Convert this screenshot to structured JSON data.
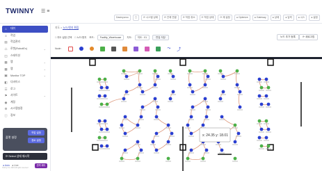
{
  "app": {
    "logo": "TWINNY",
    "menu_toggle": "☰ ≡"
  },
  "status": [
    {
      "caption": "",
      "value": "Dasinyuroo"
    },
    {
      "caption": "",
      "value": "▢"
    },
    {
      "caption": "",
      "value": "⟳ 시스템 상태"
    },
    {
      "caption": "",
      "value": "⟳ 관제 연결"
    },
    {
      "caption": "",
      "value": "⟳ 작업 취소"
    },
    {
      "caption": "",
      "value": "⟳ 작업 상태"
    },
    {
      "caption": "",
      "value": "⟳ 재 설정"
    },
    {
      "caption": "",
      "value": "● Optimize"
    },
    {
      "caption": "",
      "value": "● Gateway"
    },
    {
      "caption": "",
      "value": "● 상태"
    },
    {
      "caption": "",
      "value": "● 입력"
    },
    {
      "caption": "",
      "value": "● 시스"
    },
    {
      "caption": "",
      "value": "● 설정"
    }
  ],
  "sidebar": {
    "items": [
      {
        "label": "대쉬",
        "icon": "home-icon",
        "active": true
      },
      {
        "label": "작업",
        "icon": "list-icon"
      },
      {
        "label": "작업관리",
        "icon": "task-icon"
      },
      {
        "label": "로봇(RobotEx)",
        "icon": "robot-icon",
        "chev": "⌄"
      },
      {
        "label": "스테이션",
        "icon": "station-icon"
      },
      {
        "label": "맵",
        "icon": "map-icon",
        "chev": "⌄"
      },
      {
        "label": "맵",
        "icon": "map2-icon",
        "chev": "⌄"
      },
      {
        "label": "Monitor TOP",
        "icon": "monitor-icon",
        "chev": "⌄"
      },
      {
        "label": "디바이스",
        "icon": "device-icon"
      },
      {
        "label": "로그",
        "icon": "log-icon"
      },
      {
        "label": "사이트",
        "icon": "site-icon",
        "chev": "⌄"
      },
      {
        "label": "계정",
        "icon": "account-icon"
      },
      {
        "label": "시스템설정",
        "icon": "settings-icon"
      },
      {
        "label": "정보",
        "icon": "info-icon"
      }
    ],
    "panel_label": "플랫 설정",
    "panel_btn1": "작업 설정",
    "panel_btn2": "경로 설정",
    "dark_button": "⟳ Select 상태 재시작",
    "toggle_label": "● Auto",
    "toggle_label2": "● Live",
    "live_button": "원격 제어",
    "copyright": "Twinny Co. 2024 All rights reserved"
  },
  "content": {
    "breadcrumb": "지도 > ",
    "breadcrumb_current": "노드/엣지 편집",
    "filters": [
      "□ 지도 설정 선택",
      "□ 노드/엣지",
      "모드:",
      "지도:"
    ],
    "select1": "Facility_Warehouse",
    "select2": "지도 : 01",
    "apply_btn": "편집 저장",
    "right_btn1": "노드 추가 등록",
    "right_btn2": "⟳ 새로고침"
  },
  "toolbar": {
    "label": "Node :",
    "tools": [
      "red",
      "blue",
      "orange",
      "green",
      "darkgrey",
      "orange2",
      "purple",
      "pink",
      "green2",
      "blue2"
    ]
  },
  "colors": {
    "primary": "#3d4fc4",
    "node_blue": "#2a3fd1",
    "node_green": "#4cb048",
    "edge": "#d98a6a"
  },
  "map": {
    "label": "x: 24.35 y: 18.01"
  }
}
